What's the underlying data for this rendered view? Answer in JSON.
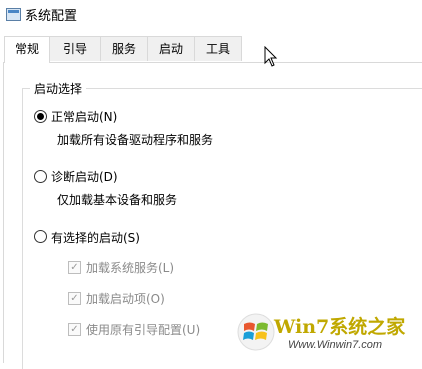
{
  "window": {
    "title": "系统配置"
  },
  "tabs": [
    {
      "label": "常规",
      "active": true
    },
    {
      "label": "引导",
      "active": false
    },
    {
      "label": "服务",
      "active": false
    },
    {
      "label": "启动",
      "active": false
    },
    {
      "label": "工具",
      "active": false
    }
  ],
  "startup_group": {
    "title": "启动选择",
    "options": [
      {
        "label": "正常启动(N)",
        "description": "加载所有设备驱动程序和服务",
        "selected": true
      },
      {
        "label": "诊断启动(D)",
        "description": "仅加载基本设备和服务",
        "selected": false
      },
      {
        "label": "有选择的启动(S)",
        "selected": false
      }
    ],
    "sub_options": [
      {
        "label": "加载系统服务(L)",
        "checked": true
      },
      {
        "label": "加载启动项(O)",
        "checked": true
      },
      {
        "label": "使用原有引导配置(U)",
        "checked": true
      }
    ]
  },
  "watermark": {
    "brand": "Win7系统之家",
    "url": "Www.Winwin7.com"
  }
}
